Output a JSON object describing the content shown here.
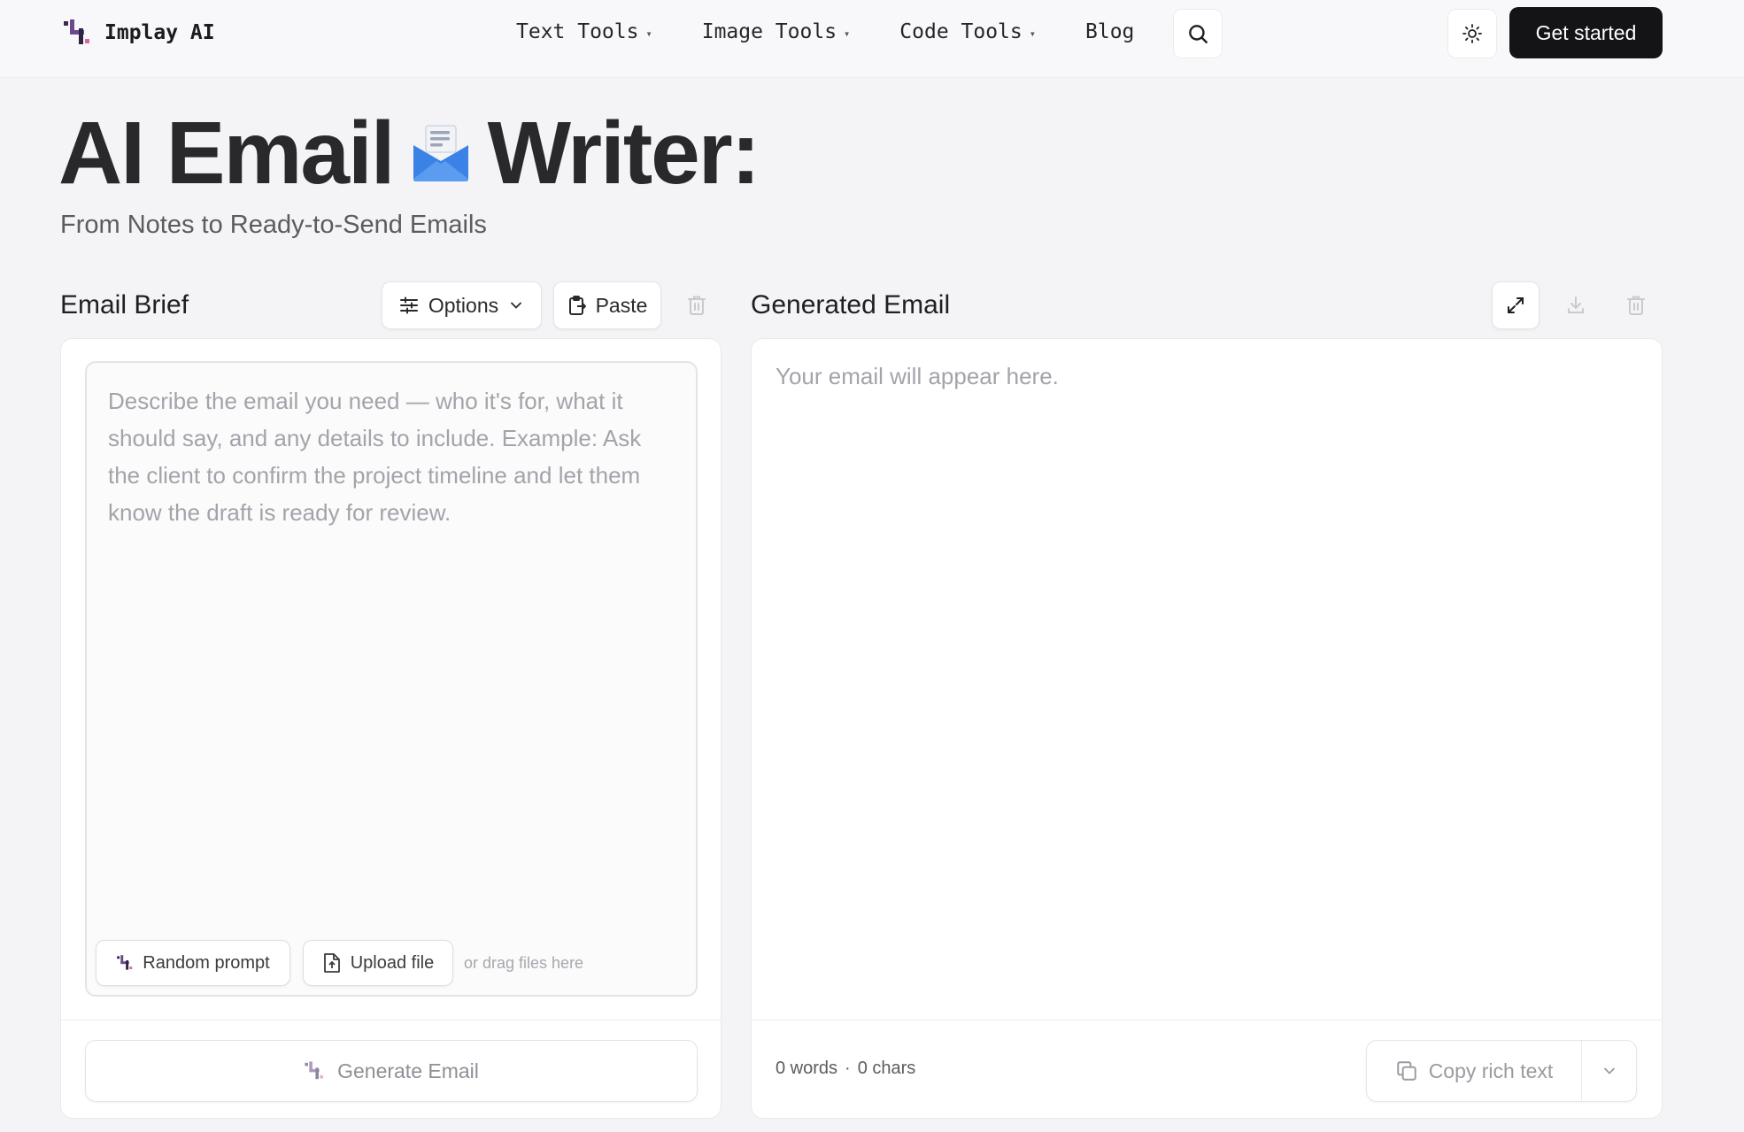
{
  "header": {
    "brand": "Implay AI",
    "nav": [
      {
        "label": "Text Tools",
        "has_dropdown": true
      },
      {
        "label": "Image Tools",
        "has_dropdown": true
      },
      {
        "label": "Code Tools",
        "has_dropdown": true
      },
      {
        "label": "Blog",
        "has_dropdown": false
      }
    ],
    "cta_label": "Get started",
    "icons": {
      "search": "search-icon",
      "theme": "sun-icon"
    }
  },
  "hero": {
    "title_part1": "AI Email",
    "title_emoji": "envelope-with-letter",
    "title_part2": "Writer:",
    "subtitle": "From Notes to Ready-to-Send Emails"
  },
  "brief": {
    "label": "Email Brief",
    "options_label": "Options",
    "paste_label": "Paste",
    "placeholder": "Describe the email you need — who it's for, what it should say, and any details to include. Example: Ask the client to confirm the project timeline and let them know the draft is ready for review.",
    "random_prompt_label": "Random prompt",
    "upload_label": "Upload file",
    "drag_hint": "or drag files here",
    "generate_label": "Generate Email"
  },
  "output": {
    "label": "Generated Email",
    "placeholder": "Your email will appear here.",
    "words": "0 words",
    "separator": "·",
    "chars": "0 chars",
    "copy_label": "Copy rich text"
  },
  "colors": {
    "background": "#f4f4f6",
    "cta_bg": "#141416",
    "envelope_blue": "#3b82e6",
    "logo_purple": "#6b4a8c",
    "logo_pink": "#d46aa0"
  }
}
